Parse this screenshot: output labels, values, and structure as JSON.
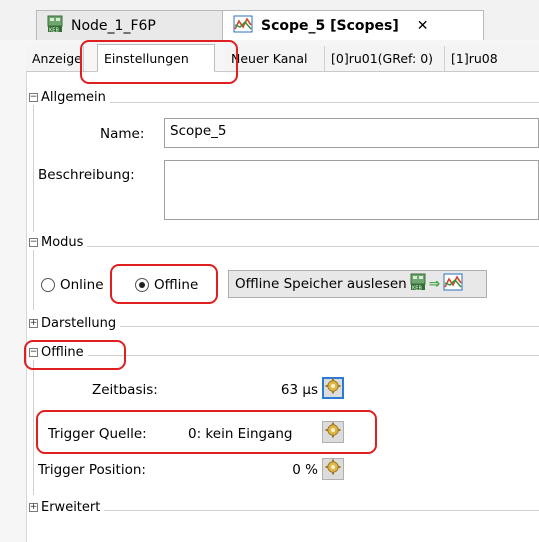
{
  "doc_tabs": [
    {
      "label": "Node_1_F6P",
      "icon": "keb-device-icon"
    },
    {
      "label": "Scope_5 [Scopes]",
      "icon": "scope-chart-icon",
      "close": "✕"
    }
  ],
  "sub_tabs": [
    "Anzeige",
    "Einstellungen",
    "Neuer Kanal",
    "[0]ru01(GRef: 0)",
    "[1]ru08"
  ],
  "allgemein": {
    "title": "Allgemein",
    "name_label": "Name:",
    "name_value": "Scope_5",
    "desc_label": "Beschreibung:",
    "desc_value": ""
  },
  "modus": {
    "title": "Modus",
    "online_label": "Online",
    "offline_label": "Offline",
    "selected": "Offline",
    "read_button": "Offline Speicher auslesen"
  },
  "darstellung": {
    "title": "Darstellung"
  },
  "offline": {
    "title": "Offline",
    "zeitbasis_label": "Zeitbasis:",
    "zeitbasis_value": "63 µs",
    "trigger_quelle_label": "Trigger Quelle:",
    "trigger_quelle_value": "0: kein Eingang",
    "trigger_position_label": "Trigger Position:",
    "trigger_position_value": "0 %"
  },
  "erweitert": {
    "title": "Erweitert"
  },
  "colors": {
    "highlight": "#e02020",
    "focus": "#2b7bd6"
  }
}
